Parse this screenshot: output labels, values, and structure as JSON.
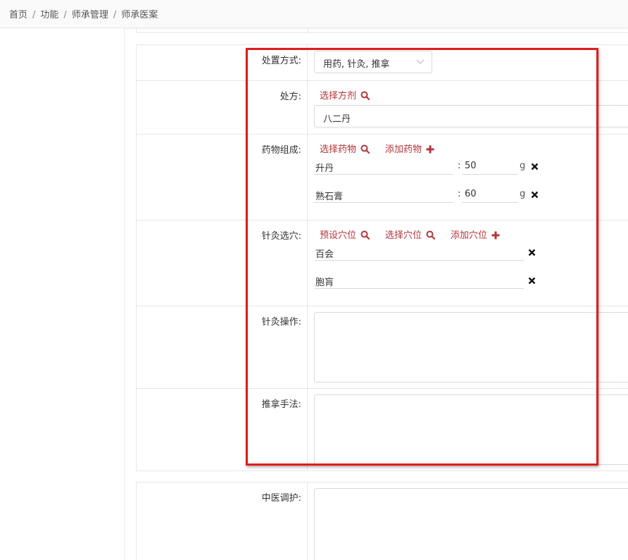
{
  "breadcrumb": {
    "items": [
      "首页",
      "功能",
      "师承管理",
      "师承医案"
    ],
    "separator": "/"
  },
  "form": {
    "treatment_method": {
      "label": "处置方式:",
      "value": "用药, 针灸, 推拿"
    },
    "prescription": {
      "label": "处方:",
      "select_label": "选择方剂",
      "value": "八二丹"
    },
    "medicine": {
      "label": "药物组成:",
      "select_label": "选择药物",
      "add_label": "添加药物",
      "items": [
        {
          "name": "升丹",
          "amount": "50",
          "unit": "g"
        },
        {
          "name": "熟石膏",
          "amount": "60",
          "unit": "g"
        }
      ]
    },
    "acupoints": {
      "label": "针灸选穴:",
      "preset_label": "预设穴位",
      "select_label": "选择穴位",
      "add_label": "添加穴位",
      "items": [
        "百会",
        "胞肓"
      ]
    },
    "acupuncture_operation": {
      "label": "针灸操作:",
      "value": ""
    },
    "massage_method": {
      "label": "推拿手法:",
      "value": ""
    },
    "tcm_care": {
      "label": "中医调护:",
      "value": ""
    }
  },
  "colors": {
    "accent": "#b3343a",
    "highlight_border": "#e01b1b"
  }
}
